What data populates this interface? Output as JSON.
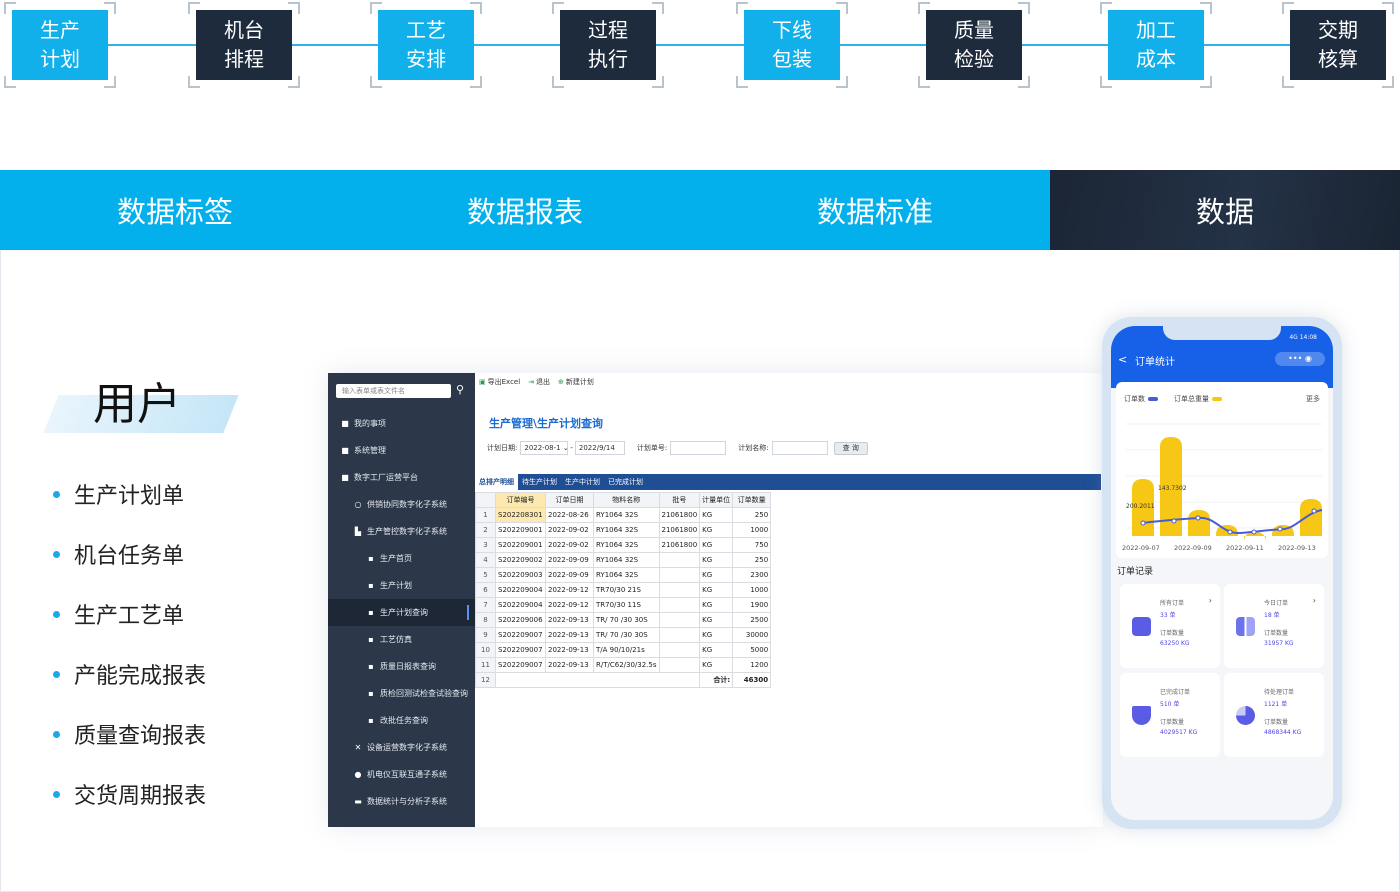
{
  "steps": [
    {
      "label": "生产\n计划",
      "style": "blue"
    },
    {
      "label": "机台\n排程",
      "style": "dark"
    },
    {
      "label": "工艺\n安排",
      "style": "blue"
    },
    {
      "label": "过程\n执行",
      "style": "dark"
    },
    {
      "label": "下线\n包装",
      "style": "blue"
    },
    {
      "label": "质量\n检验",
      "style": "dark"
    },
    {
      "label": "加工\n成本",
      "style": "blue"
    },
    {
      "label": "交期\n核算",
      "style": "dark"
    }
  ],
  "tabs": [
    {
      "label": "数据标签",
      "active": false
    },
    {
      "label": "数据报表",
      "active": false
    },
    {
      "label": "数据标准",
      "active": false
    },
    {
      "label": "数据",
      "active": true
    }
  ],
  "user": {
    "title": "用户",
    "features": [
      "生产计划单",
      "机台任务单",
      "生产工艺单",
      "产能完成报表",
      "质量查询报表",
      "交货周期报表"
    ]
  },
  "desktop": {
    "search_placeholder": "输入表单或表文件名",
    "sidebar": [
      {
        "label": "我的事项",
        "icon": "folder-icon",
        "level": 0
      },
      {
        "label": "系统管理",
        "icon": "folder-icon",
        "level": 0
      },
      {
        "label": "数字工厂运营平台",
        "icon": "folder-icon",
        "level": 0
      },
      {
        "label": "供销协同数字化子系统",
        "icon": "circle-icon",
        "level": 1
      },
      {
        "label": "生产管控数字化子系统",
        "icon": "doc-icon",
        "level": 1
      },
      {
        "label": "生产首页",
        "icon": "file-icon",
        "level": 2
      },
      {
        "label": "生产计划",
        "icon": "file-icon",
        "level": 2
      },
      {
        "label": "生产计划查询",
        "icon": "file-icon",
        "level": 2,
        "active": true
      },
      {
        "label": "工艺仿真",
        "icon": "file-icon",
        "level": 2
      },
      {
        "label": "质量日报表查询",
        "icon": "file-icon",
        "level": 2
      },
      {
        "label": "质检回测试检查试验查询",
        "icon": "file-icon",
        "level": 2
      },
      {
        "label": "改批任务查询",
        "icon": "file-icon",
        "level": 2
      },
      {
        "label": "设备运营数字化子系统",
        "icon": "tools-icon",
        "level": 1
      },
      {
        "label": "机电仪互联互通子系统",
        "icon": "gear-icon",
        "level": 1
      },
      {
        "label": "数据统计与分析子系统",
        "icon": "chart-icon",
        "level": 1
      }
    ],
    "toolbar": [
      {
        "label": "导出Excel",
        "icon": "excel-icon"
      },
      {
        "label": "退出",
        "icon": "exit-icon"
      },
      {
        "label": "新建计划",
        "icon": "plus-icon"
      }
    ],
    "breadcrumb": "生产管理\\生产计划查询",
    "query": {
      "date_label": "计划日期:",
      "date_from": "2022-08-1",
      "date_to": "2022/9/14",
      "order_label": "计划单号:",
      "name_label": "计划名称:",
      "query_button": "查 询"
    },
    "subtabs": [
      {
        "label": "总排产明细",
        "active": true
      },
      {
        "label": "待生产计划",
        "active": false
      },
      {
        "label": "生产中计划",
        "active": false
      },
      {
        "label": "已完成计划",
        "active": false
      }
    ],
    "table": {
      "headers": [
        "订单编号",
        "订单日期",
        "物料名称",
        "批号",
        "计量单位",
        "订单数量"
      ],
      "rows": [
        [
          "1",
          "S202208301",
          "2022-08-26",
          "RY1064 32S",
          "21061800",
          "KG",
          "250"
        ],
        [
          "2",
          "S202209001",
          "2022-09-02",
          "RY1064 32S",
          "21061800",
          "KG",
          "1000"
        ],
        [
          "3",
          "S202209001",
          "2022-09-02",
          "RY1064 32S",
          "21061800",
          "KG",
          "750"
        ],
        [
          "4",
          "S202209002",
          "2022-09-09",
          "RY1064 32S",
          "",
          "KG",
          "250"
        ],
        [
          "5",
          "S202209003",
          "2022-09-09",
          "RY1064 32S",
          "",
          "KG",
          "2300"
        ],
        [
          "6",
          "S202209004",
          "2022-09-12",
          "TR70/30 21S",
          "",
          "KG",
          "1000"
        ],
        [
          "7",
          "S202209004",
          "2022-09-12",
          "TR70/30 11S",
          "",
          "KG",
          "1900"
        ],
        [
          "8",
          "S202209006",
          "2022-09-13",
          "TR/ 70 /30 30S",
          "",
          "KG",
          "2500"
        ],
        [
          "9",
          "S202209007",
          "2022-09-13",
          "TR/ 70 /30 30S",
          "",
          "KG",
          "30000"
        ],
        [
          "10",
          "S202209007",
          "2022-09-13",
          "T/A 90/10/21s",
          "",
          "KG",
          "5000"
        ],
        [
          "11",
          "S202209007",
          "2022-09-13",
          "R/T/C62/30/32.5s",
          "",
          "KG",
          "1200"
        ]
      ],
      "total_row_no": "12",
      "total_label": "合计:",
      "total_value": "46300"
    }
  },
  "phone": {
    "status": "4G 14:08",
    "back": "<",
    "title": "订单统计",
    "capsule": "•••  ◉",
    "legend_orders": "订单数",
    "legend_weight": "订单总重量",
    "more": "更多",
    "colors": {
      "orders": "#4a5bd8",
      "weight": "#f6c714",
      "header": "#1760e8"
    },
    "chart_labels": [
      "143.7302",
      "200.2011"
    ],
    "x_labels": [
      "2022-09-07",
      "2022-09-09",
      "2022-09-11",
      "2022-09-13"
    ],
    "section": "订单记录",
    "cards": [
      {
        "l1": "所有订单",
        "v1": "33 单",
        "l2": "订单数量",
        "v2": "63250 KG",
        "icon": "document-icon",
        "color": "#5a5ce6"
      },
      {
        "l1": "今日订单",
        "v1": "18 单",
        "l2": "订单数量",
        "v2": "31957 KG",
        "icon": "grid-icon",
        "color": "#6b72ea"
      },
      {
        "l1": "已完成订单",
        "v1": "510 单",
        "l2": "订单数量",
        "v2": "4029517 KG",
        "icon": "shield-icon",
        "color": "#5a5ce6"
      },
      {
        "l1": "待处理订单",
        "v1": "1121 单",
        "l2": "订单数量",
        "v2": "4868344 KG",
        "icon": "pie-icon",
        "color": "#5a5ce6"
      }
    ]
  }
}
